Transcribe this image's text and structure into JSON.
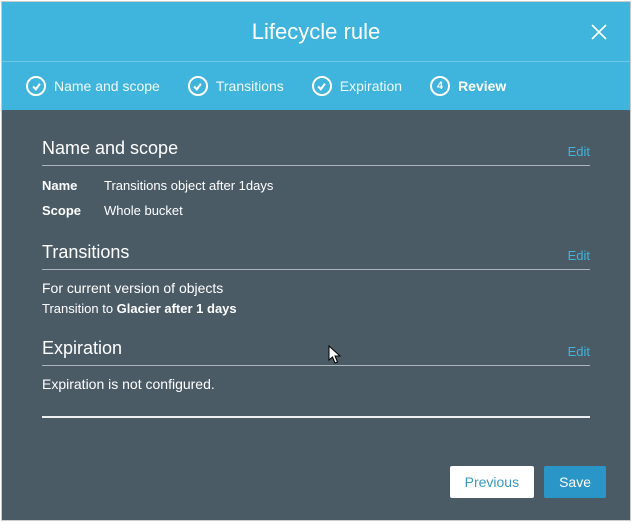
{
  "dialog": {
    "title": "Lifecycle rule"
  },
  "steps": [
    {
      "label": "Name and scope",
      "completed": true,
      "current": false
    },
    {
      "label": "Transitions",
      "completed": true,
      "current": false
    },
    {
      "label": "Expiration",
      "completed": true,
      "current": false
    },
    {
      "label": "Review",
      "number": "4",
      "completed": false,
      "current": true
    }
  ],
  "sections": {
    "name_and_scope": {
      "title": "Name and scope",
      "edit": "Edit",
      "rows": {
        "name_label": "Name",
        "name_value": "Transitions object after 1days",
        "scope_label": "Scope",
        "scope_value": "Whole bucket"
      }
    },
    "transitions": {
      "title": "Transitions",
      "edit": "Edit",
      "subhead": "For current version of objects",
      "detail_prefix": "Transition to ",
      "detail_value": "Glacier after 1 days"
    },
    "expiration": {
      "title": "Expiration",
      "edit": "Edit",
      "message": "Expiration is not configured."
    }
  },
  "footer": {
    "previous": "Previous",
    "save": "Save"
  }
}
